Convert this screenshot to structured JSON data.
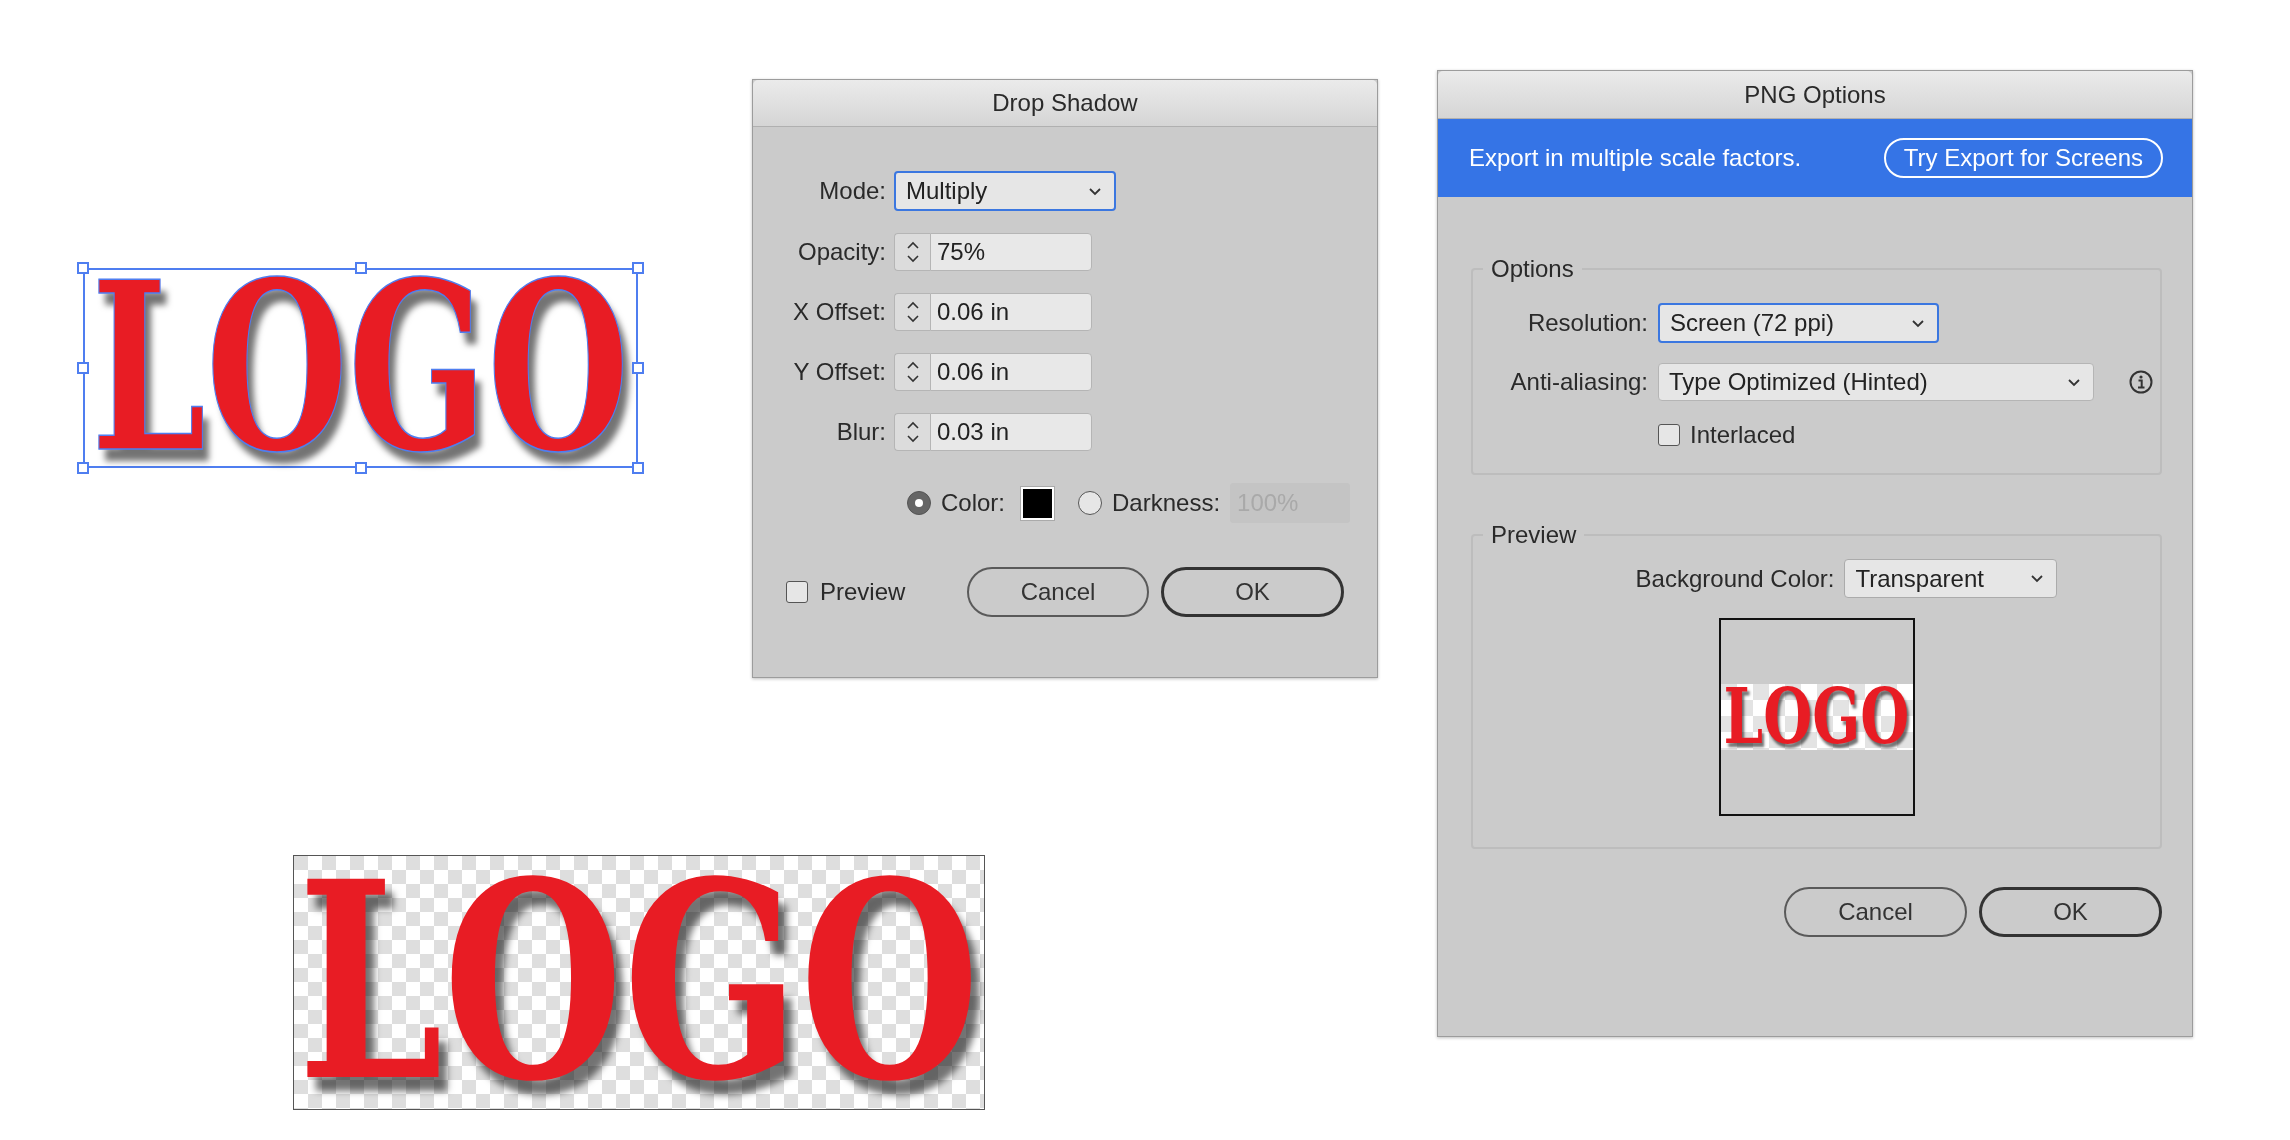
{
  "artwork": {
    "text": "LOGO",
    "selected": true
  },
  "drop_shadow_dialog": {
    "title": "Drop Shadow",
    "fields": [
      {
        "label": "Mode:",
        "kind": "dropdown",
        "value": "Multiply",
        "focused": true
      },
      {
        "label": "Opacity:",
        "kind": "spinner",
        "value": "75%"
      },
      {
        "label": "X Offset:",
        "kind": "spinner",
        "value": "0.06 in"
      },
      {
        "label": "Y Offset:",
        "kind": "spinner",
        "value": "0.06 in"
      },
      {
        "label": "Blur:",
        "kind": "spinner",
        "value": "0.03 in"
      }
    ],
    "shadow_source": [
      {
        "label": "Color:",
        "kind": "swatch",
        "selected": true
      },
      {
        "label": "Darkness:",
        "kind": "field",
        "value": "100%",
        "selected": false,
        "disabled": true
      }
    ],
    "preview": {
      "label": "Preview",
      "checked": false
    },
    "buttons": [
      {
        "label": "Cancel",
        "default": false
      },
      {
        "label": "OK",
        "default": true
      }
    ]
  },
  "png_options_dialog": {
    "title": "PNG Options",
    "banner": {
      "text": "Export in multiple scale factors.",
      "button": "Try Export for Screens"
    },
    "options_group": {
      "legend": "Options",
      "fields": [
        {
          "label": "Resolution:",
          "value": "Screen (72 ppi)",
          "focused": true,
          "info": false
        },
        {
          "label": "Anti-aliasing:",
          "value": "Type Optimized (Hinted)",
          "focused": false,
          "info": true
        }
      ],
      "interlaced": {
        "label": "Interlaced",
        "checked": false
      }
    },
    "preview_group": {
      "legend": "Preview",
      "background_color": {
        "label": "Background Color:",
        "value": "Transparent"
      },
      "thumbnail": {
        "text": "LOGO"
      }
    },
    "buttons": [
      {
        "label": "Cancel",
        "default": false
      },
      {
        "label": "OK",
        "default": true
      }
    ]
  },
  "exported_image": {
    "text": "LOGO"
  }
}
